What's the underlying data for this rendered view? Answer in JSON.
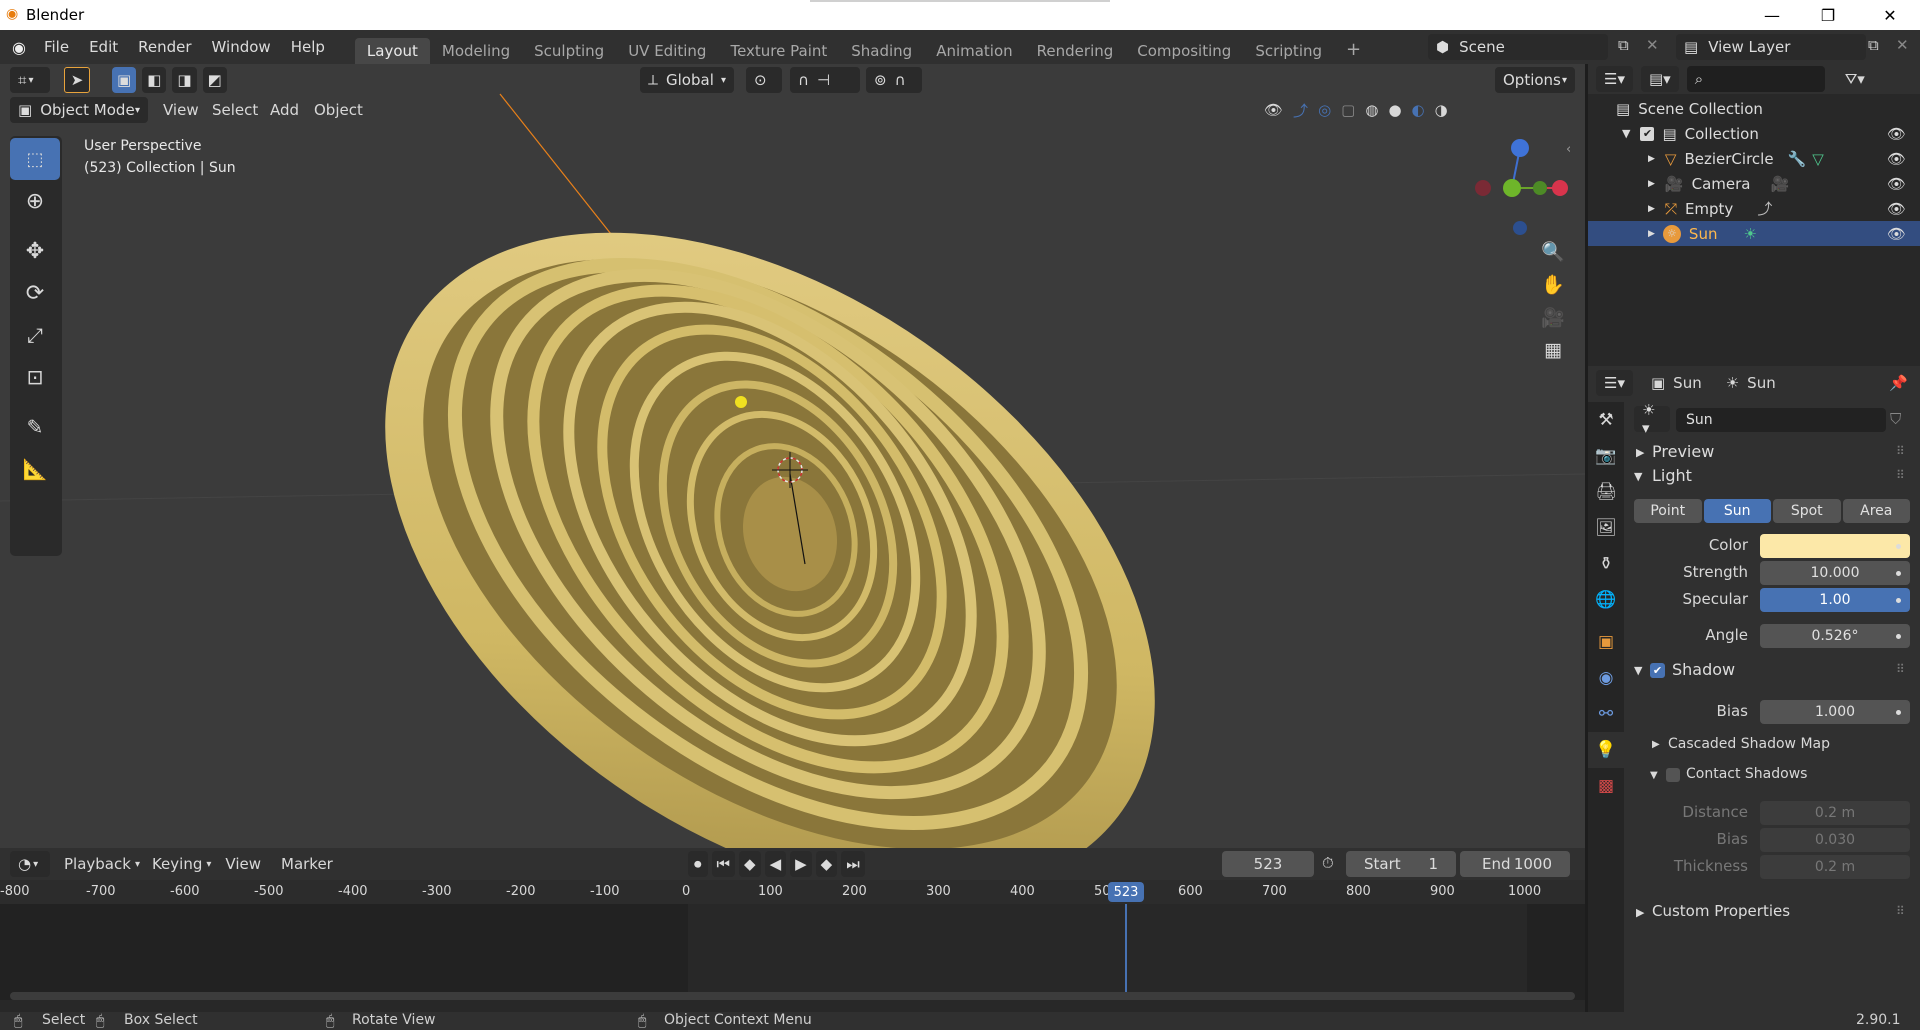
{
  "window": {
    "title": "Blender"
  },
  "menu": [
    "File",
    "Edit",
    "Render",
    "Window",
    "Help"
  ],
  "workspaces": [
    "Layout",
    "Modeling",
    "Sculpting",
    "UV Editing",
    "Texture Paint",
    "Shading",
    "Animation",
    "Rendering",
    "Compositing",
    "Scripting"
  ],
  "scene": {
    "name": "Scene",
    "view_layer": "View Layer"
  },
  "viewport": {
    "orientation": "Global",
    "options_label": "Options",
    "mode": "Object Mode",
    "header_menu": [
      "View",
      "Select",
      "Add",
      "Object"
    ],
    "info_line1": "User Perspective",
    "info_line2": "(523) Collection | Sun",
    "gizmo": {
      "x": "X",
      "y": "Y",
      "z": "Z"
    }
  },
  "outliner": {
    "root": "Scene Collection",
    "collection": "Collection",
    "items": [
      "BezierCircle",
      "Camera",
      "Empty",
      "Sun"
    ]
  },
  "properties": {
    "header_object": "Sun",
    "header_data": "Sun",
    "datablock_name": "Sun",
    "sections": {
      "preview": "Preview",
      "light": "Light",
      "shadow": "Shadow",
      "custom": "Custom Properties"
    },
    "light_types": [
      "Point",
      "Sun",
      "Spot",
      "Area"
    ],
    "active_light_type": "Sun",
    "color_label": "Color",
    "color_value": "#fce8a8",
    "strength_label": "Strength",
    "strength": "10.000",
    "specular_label": "Specular",
    "specular": "1.00",
    "angle_label": "Angle",
    "angle": "0.526°",
    "bias_label": "Bias",
    "bias": "1.000",
    "cascaded": "Cascaded Shadow Map",
    "contact": "Contact Shadows",
    "distance_label": "Distance",
    "distance": "0.2 m",
    "contact_bias_label": "Bias",
    "contact_bias": "0.030",
    "thickness_label": "Thickness",
    "thickness": "0.2 m"
  },
  "timeline": {
    "menus": [
      "Playback",
      "Keying",
      "View",
      "Marker"
    ],
    "current_frame": "523",
    "start_label": "Start",
    "start": "1",
    "end_label": "End",
    "end": "1000",
    "ruler": [
      "-800",
      "-700",
      "-600",
      "-500",
      "-400",
      "-300",
      "-200",
      "-100",
      "0",
      "100",
      "200",
      "300",
      "400",
      "50",
      "600",
      "700",
      "800",
      "900",
      "1000"
    ]
  },
  "status": {
    "select": "Select",
    "box_select": "Box Select",
    "rotate": "Rotate View",
    "context": "Object Context Menu",
    "version": "2.90.1"
  },
  "colors": {
    "accent": "#4772b3",
    "selection": "#334d80",
    "object": "#d9c275"
  }
}
